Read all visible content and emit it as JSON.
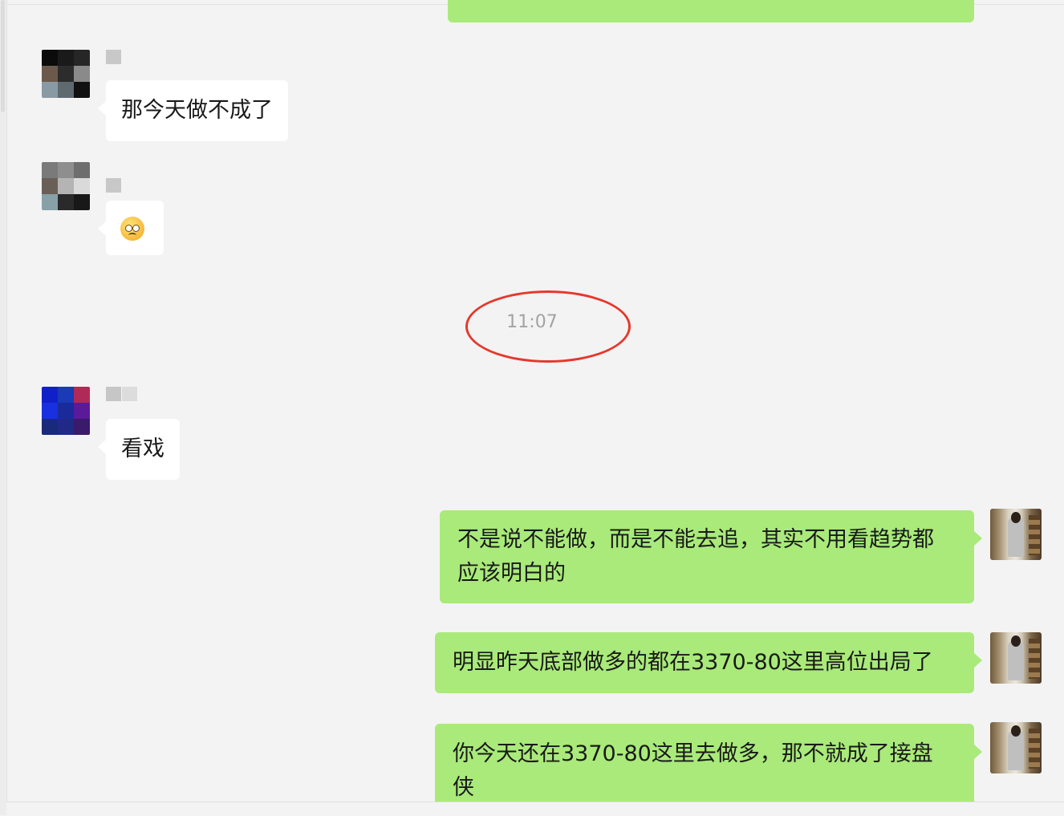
{
  "timestamp": "11:07",
  "messages": [
    {
      "side": "received",
      "text": "那今天做不成了"
    },
    {
      "side": "received",
      "emoji": "pleading-face"
    },
    {
      "side": "received",
      "text": "看戏"
    },
    {
      "side": "sent",
      "lines": [
        "不是说不能做，而是不能去追，其实不用看趋势都",
        "应该明白的"
      ]
    },
    {
      "side": "sent",
      "text": "明显昨天底部做多的都在3370-80这里高位出局了"
    },
    {
      "side": "sent",
      "lines": [
        "你今天还在3370-80这里去做多，那不就成了接盘",
        "侠"
      ]
    }
  ],
  "colors": {
    "background": "#f3f3f3",
    "sent_bubble": "#a9ea7a",
    "received_bubble": "#ffffff",
    "timestamp_text": "#a3a3a3",
    "annotation_circle": "#e5392c"
  }
}
